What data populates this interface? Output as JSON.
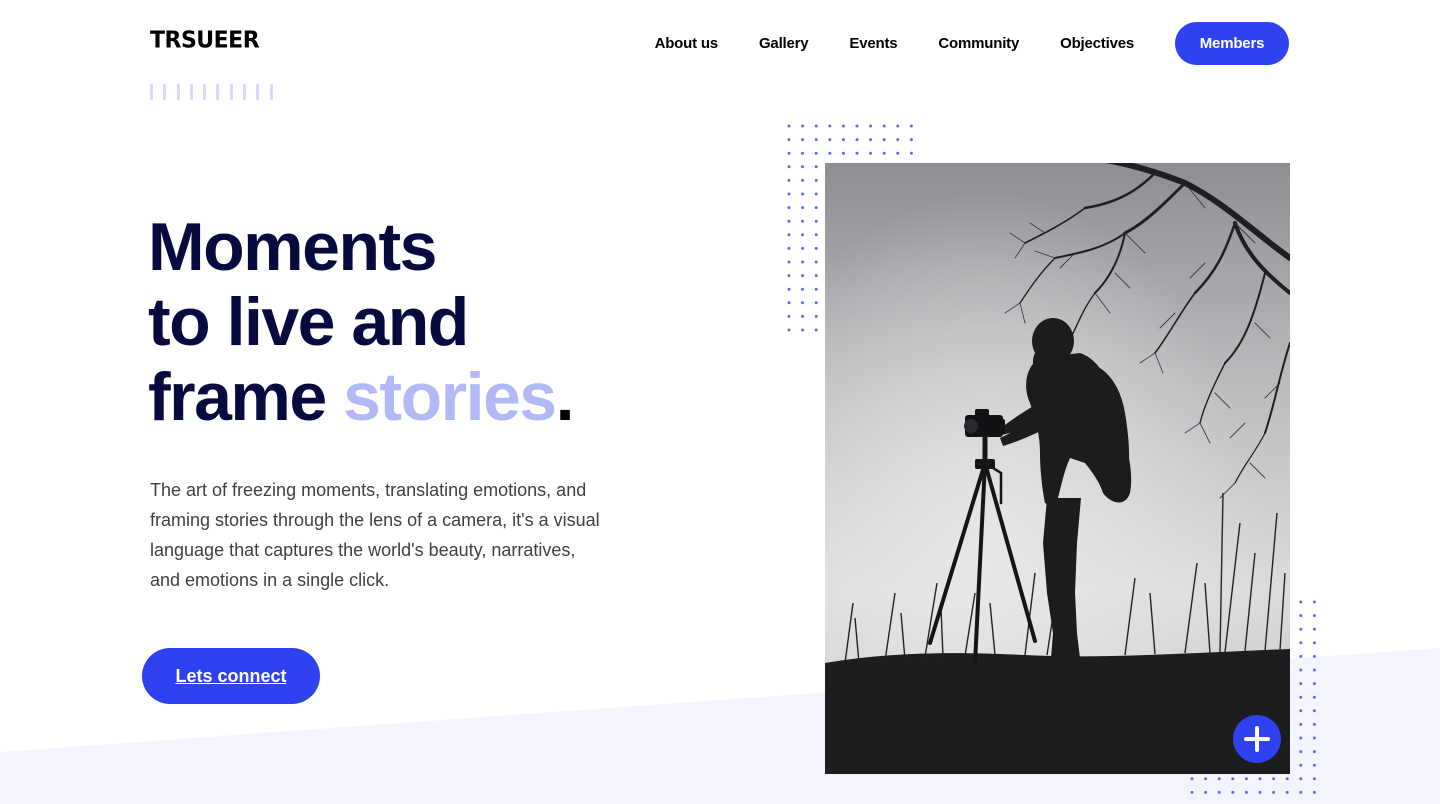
{
  "brand": {
    "logo_text": "TRSUEER"
  },
  "nav": {
    "items": [
      "About us",
      "Gallery",
      "Events",
      "Community",
      "Objectives"
    ],
    "members_label": "Members"
  },
  "hero": {
    "line1": "Moments",
    "line2": "to live and",
    "line3_start": "frame ",
    "line3_accent": "stories",
    "line3_end": ".",
    "description": "The art of freezing moments, translating emotions, and framing stories through the lens of a camera, it's a visual language that captures the world's beauty, narratives, and emotions in a single click.",
    "cta_label": "Lets connect"
  },
  "photo": {
    "subject": "silhouette of photographer with camera on tripod under bare tree"
  },
  "icons": {
    "plus": "plus-icon"
  },
  "colors": {
    "accent": "#2f42f2",
    "heading": "#070a3f",
    "accent_light": "#b3b9f6",
    "wedge": "#f3f4fe"
  }
}
